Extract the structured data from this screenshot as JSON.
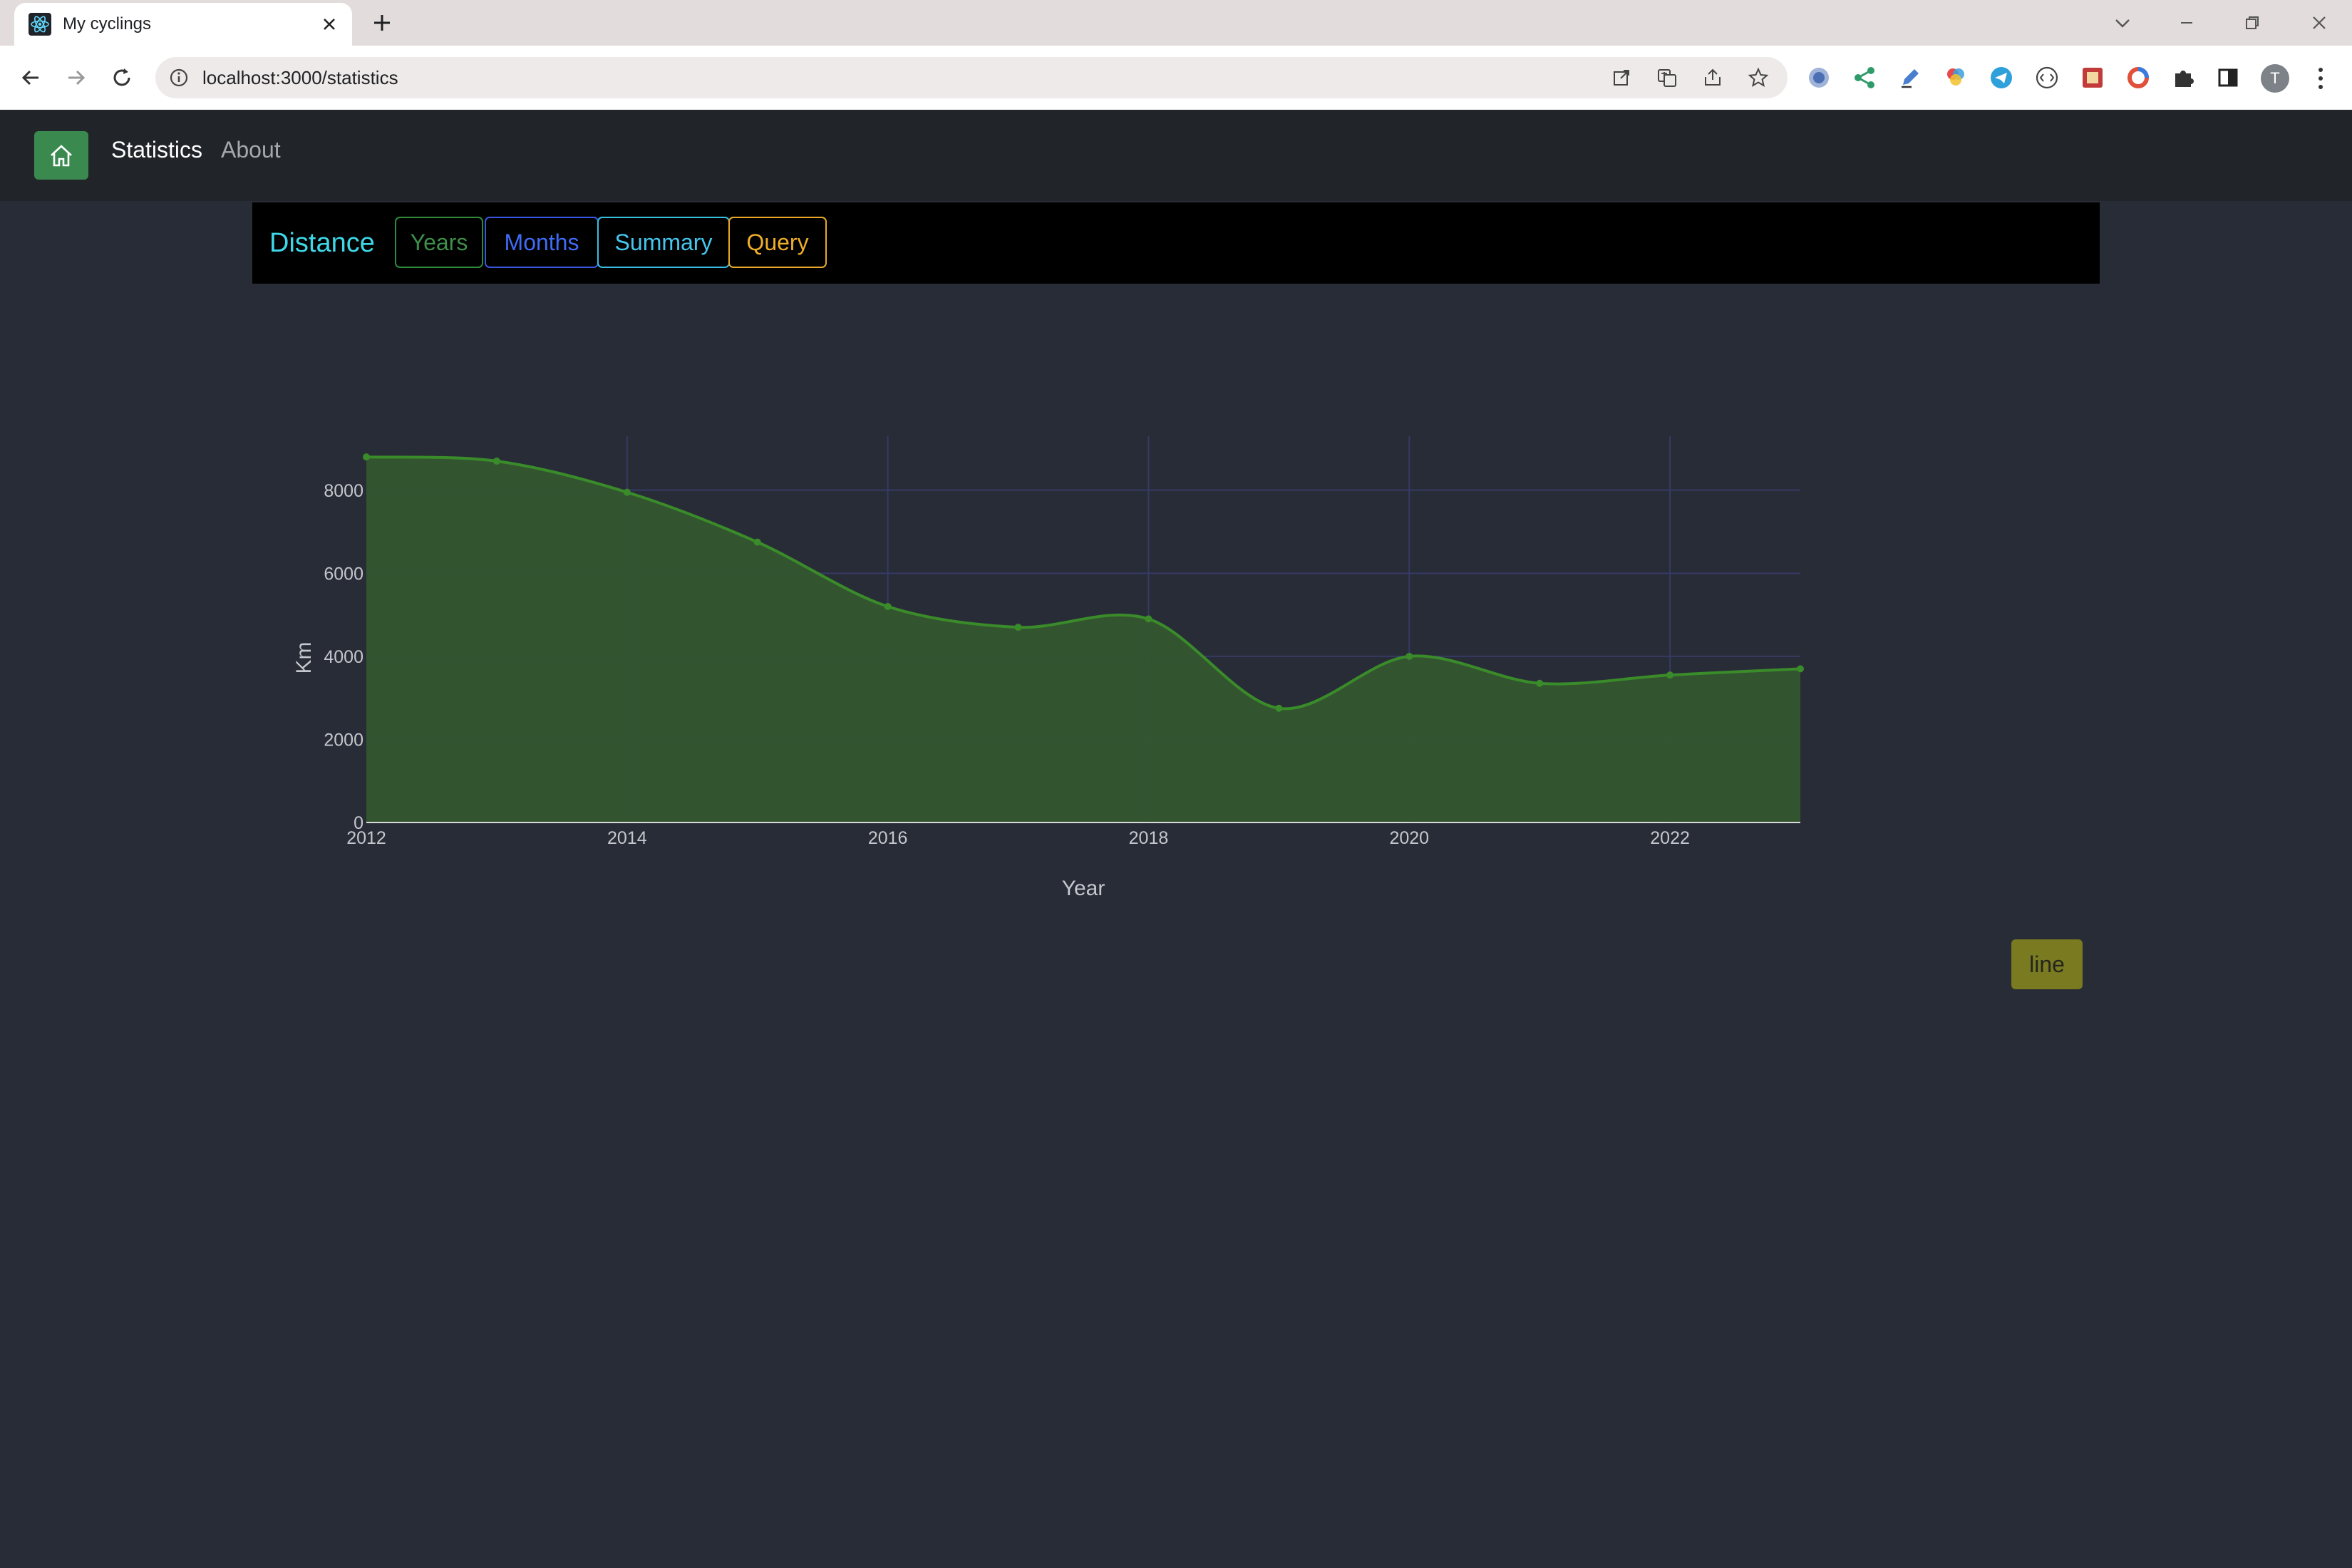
{
  "browser": {
    "tab_title": "My cyclings",
    "url": "localhost:3000/statistics",
    "profile_initial": "T"
  },
  "navbar": {
    "links": [
      "Statistics",
      "About"
    ]
  },
  "panel": {
    "title": "Distance",
    "tabs": [
      {
        "label": "Years",
        "color": "#2f8a3c"
      },
      {
        "label": "Months",
        "color": "#3a56e0"
      },
      {
        "label": "Summary",
        "color": "#38bde0"
      },
      {
        "label": "Query",
        "color": "#e8a92a"
      }
    ]
  },
  "chart_data": {
    "type": "area",
    "x": [
      2012,
      2013,
      2014,
      2015,
      2016,
      2017,
      2018,
      2019,
      2020,
      2021,
      2022,
      2023
    ],
    "series": [
      {
        "values": [
          8800,
          8700,
          7950,
          6750,
          5200,
          4700,
          4900,
          2750,
          4000,
          3350,
          3550,
          3700
        ]
      }
    ],
    "xlabel": "Year",
    "ylabel": "Km",
    "xlim": [
      2012,
      2023
    ],
    "ylim": [
      0,
      9300
    ],
    "xticks": [
      2012,
      2014,
      2016,
      2018,
      2020,
      2022
    ],
    "yticks": [
      0,
      2000,
      4000,
      6000,
      8000
    ],
    "grid": true,
    "line_shape": "spline",
    "colors": {
      "fill": "#33562f",
      "line": "#3a8b2a",
      "grid": "#363a66",
      "tick_text": "#c4c7cc"
    }
  },
  "chart_type_button": {
    "label": "line"
  }
}
